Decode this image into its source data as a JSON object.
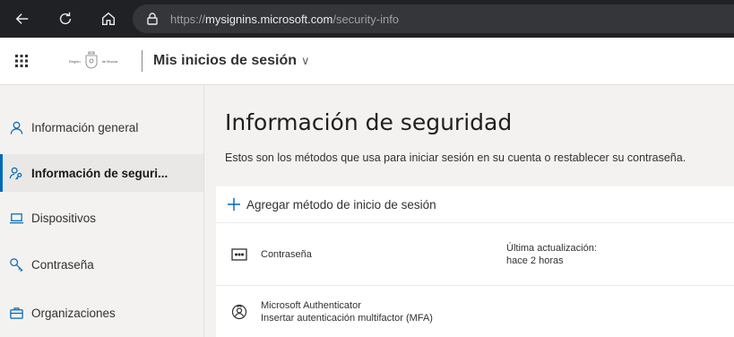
{
  "browser": {
    "url_prefix": "https://",
    "url_host": "mysignins.microsoft.com",
    "url_path": "/security-info"
  },
  "header": {
    "org_logo_left": "Región",
    "org_logo_right": "de Murcia",
    "app_title": "Mis inicios de sesión",
    "app_title_chevron": "∨"
  },
  "sidebar": {
    "items": [
      {
        "label": "Información general",
        "icon": "person-icon"
      },
      {
        "label": "Información de seguri...",
        "icon": "person-key-icon",
        "active": true
      },
      {
        "label": "Dispositivos",
        "icon": "laptop-icon"
      },
      {
        "label": "Contraseña",
        "icon": "key-icon"
      },
      {
        "label": "Organizaciones",
        "icon": "briefcase-icon"
      }
    ]
  },
  "main": {
    "title": "Información de seguridad",
    "description": "Estos son los métodos que usa para iniciar sesión en su cuenta o restablecer su contraseña.",
    "add_method_label": "Agregar método de inicio de sesión",
    "methods": [
      {
        "name": "Contraseña",
        "icon": "password-dots-icon",
        "detail_label": "Última actualización:",
        "detail_value": "hace 2 horas"
      },
      {
        "name": "Microsoft Authenticator",
        "subtitle": "Insertar autenticación multifactor (MFA)",
        "icon": "authenticator-icon"
      }
    ]
  },
  "colors": {
    "accent": "#0067b8",
    "browser_bg": "#202124",
    "page_bg": "#f3f2f1"
  }
}
